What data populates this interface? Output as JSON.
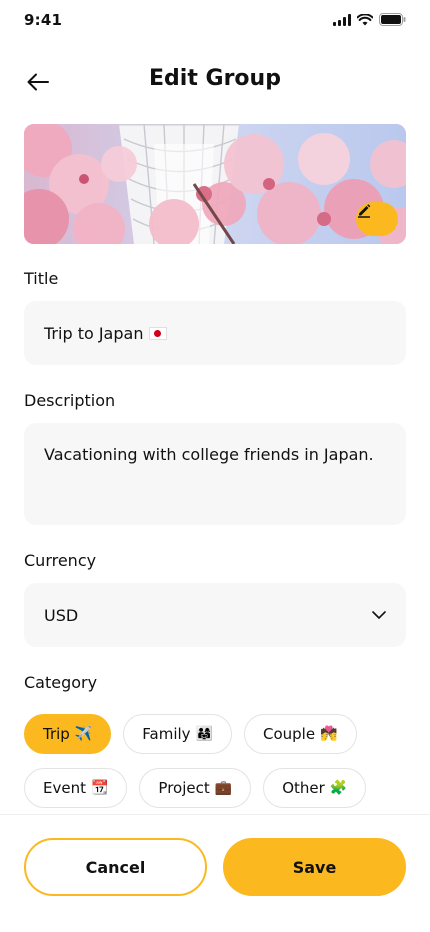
{
  "status_bar": {
    "time": "9:41"
  },
  "header": {
    "title": "Edit Group",
    "back_icon": "arrow-left-icon"
  },
  "cover": {
    "edit_icon": "pencil-icon"
  },
  "form": {
    "title_label": "Title",
    "title_value": "Trip to Japan",
    "title_emoji": "japan-flag",
    "description_label": "Description",
    "description_value": "Vacationing with college friends in Japan.",
    "currency_label": "Currency",
    "currency_value": "USD",
    "category_label": "Category"
  },
  "categories": [
    {
      "label": "Trip",
      "emoji": "✈️",
      "selected": true
    },
    {
      "label": "Family",
      "emoji": "👨‍👩‍👧",
      "selected": false
    },
    {
      "label": "Couple",
      "emoji": "💏",
      "selected": false
    },
    {
      "label": "Event",
      "emoji": "📆",
      "selected": false
    },
    {
      "label": "Project",
      "emoji": "💼",
      "selected": false
    },
    {
      "label": "Other",
      "emoji": "🧩",
      "selected": false
    }
  ],
  "actions": {
    "cancel_label": "Cancel",
    "save_label": "Save"
  },
  "colors": {
    "accent": "#fbb91f",
    "field_background": "#f7f7f7"
  }
}
